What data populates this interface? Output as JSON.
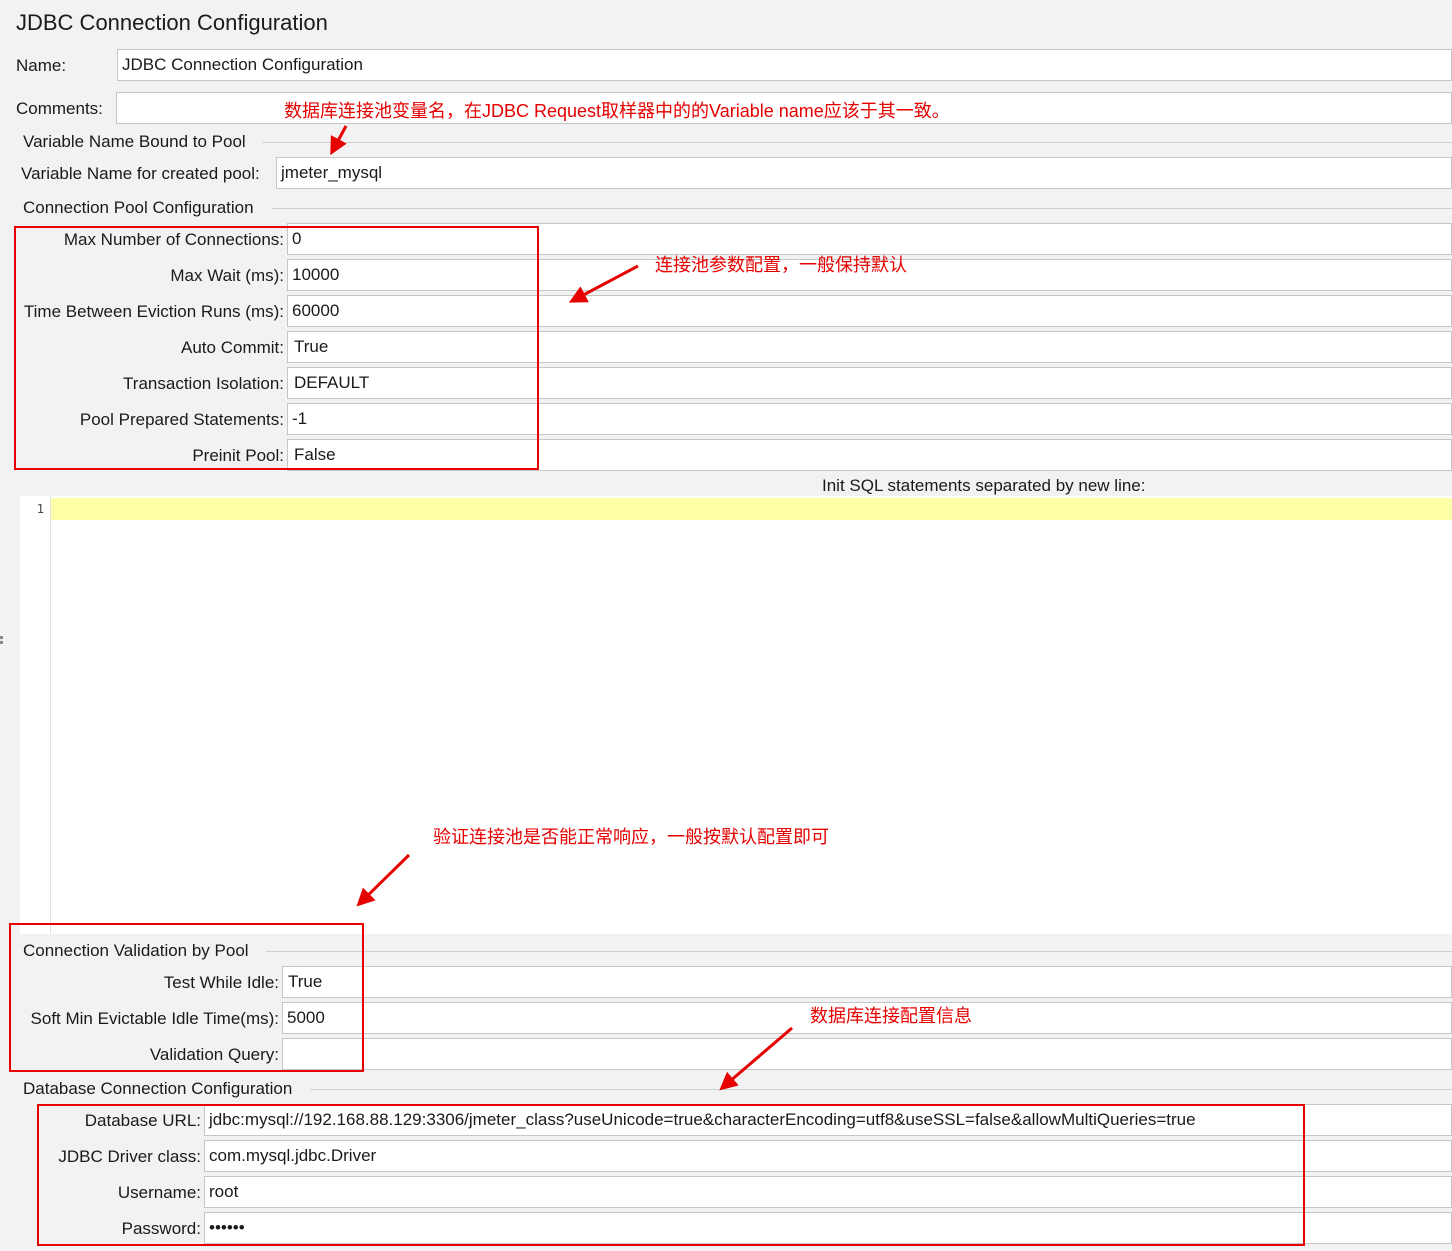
{
  "title": "JDBC Connection Configuration",
  "name": {
    "label": "Name:",
    "value": "JDBC Connection Configuration"
  },
  "comments": {
    "label": "Comments:",
    "value": ""
  },
  "variable_section": {
    "title": "Variable Name Bound to Pool",
    "label": "Variable Name for created pool:",
    "value": "jmeter_mysql"
  },
  "pool_section": {
    "title": "Connection Pool Configuration",
    "fields": [
      {
        "label": "Max Number of Connections:",
        "value": "0"
      },
      {
        "label": "Max Wait (ms):",
        "value": "10000"
      },
      {
        "label": "Time Between Eviction Runs (ms):",
        "value": "60000"
      },
      {
        "label": "Auto Commit:",
        "value": "True"
      },
      {
        "label": "Transaction Isolation:",
        "value": "DEFAULT"
      },
      {
        "label": "Pool Prepared Statements:",
        "value": "-1"
      },
      {
        "label": "Preinit Pool:",
        "value": "False"
      }
    ]
  },
  "init_sql": {
    "label": "Init SQL statements separated by new line:",
    "line_number": "1"
  },
  "validation_section": {
    "title": "Connection Validation by Pool",
    "fields": [
      {
        "label": "Test While Idle:",
        "value": "True"
      },
      {
        "label": "Soft Min Evictable Idle Time(ms):",
        "value": "5000"
      },
      {
        "label": "Validation Query:",
        "value": ""
      }
    ]
  },
  "database_section": {
    "title": "Database Connection Configuration",
    "fields": [
      {
        "label": "Database URL:",
        "value": "jdbc:mysql://192.168.88.129:3306/jmeter_class?useUnicode=true&characterEncoding=utf8&useSSL=false&allowMultiQueries=true"
      },
      {
        "label": "JDBC Driver class:",
        "value": "com.mysql.jdbc.Driver"
      },
      {
        "label": "Username:",
        "value": "root"
      },
      {
        "label": "Password:",
        "value": "••••••"
      }
    ]
  },
  "annotations": {
    "variable_note": "数据库连接池变量名，在JDBC Request取样器中的的Variable name应该于其一致。",
    "pool_note": "连接池参数配置，一般保持默认",
    "validation_note": "验证连接池是否能正常响应，一般按默认配置即可",
    "database_note": "数据库连接配置信息"
  },
  "colors": {
    "annotation_red": "#e60000",
    "current_line_highlight": "#ffffa8",
    "background": "#f2f2f2"
  }
}
